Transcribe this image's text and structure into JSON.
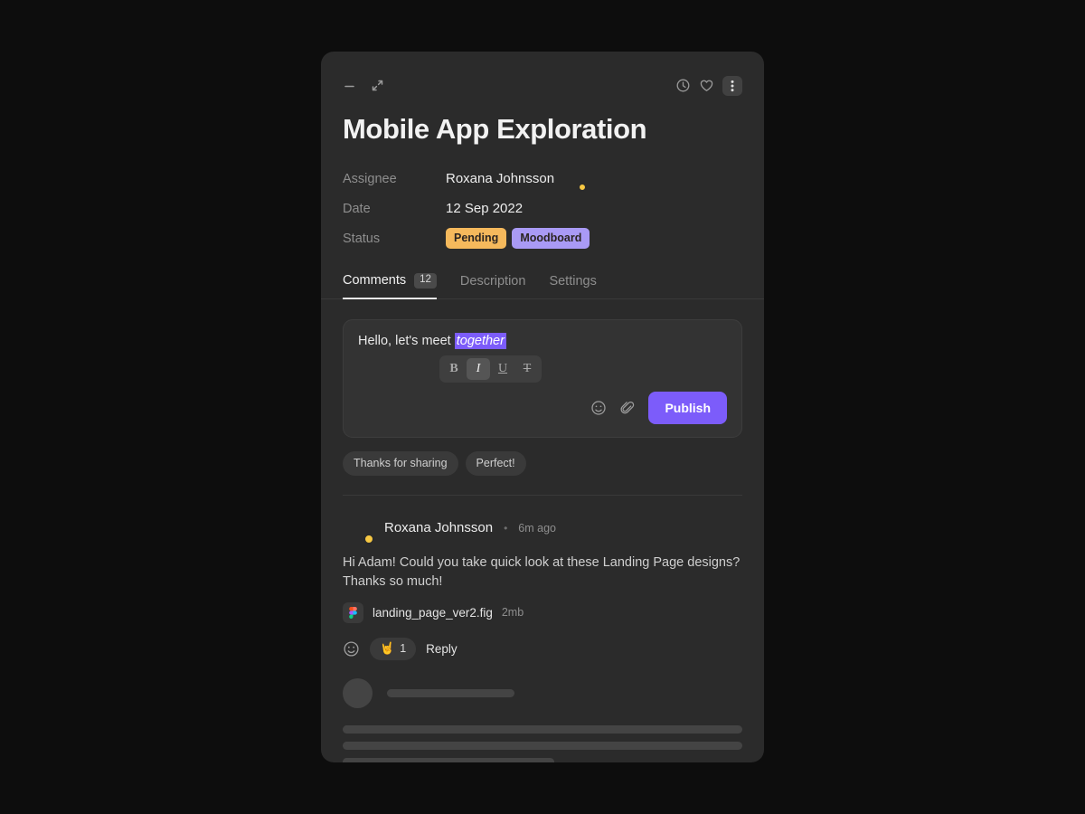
{
  "window": {
    "minimize_label": "minimize",
    "expand_label": "expand",
    "history_label": "history",
    "favorite_label": "favorite",
    "more_label": "more options"
  },
  "title": "Mobile App Exploration",
  "meta": [
    {
      "label": "Assignee",
      "value": "Roxana Johnsson"
    },
    {
      "label": "Date",
      "value": "12 Sep 2022"
    },
    {
      "label": "Status",
      "value": ""
    }
  ],
  "status_badges": [
    {
      "text": "Pending",
      "color": "#f5b95c"
    },
    {
      "text": "Moodboard",
      "color": "#a99af5"
    }
  ],
  "tabs": [
    {
      "label": "Comments",
      "badge": "12",
      "active": true
    },
    {
      "label": "Description",
      "badge": "",
      "active": false
    },
    {
      "label": "Settings",
      "badge": "",
      "active": false
    }
  ],
  "composer": {
    "text_before": "Hello, let's meet ",
    "selected_text": "together",
    "format_buttons": [
      {
        "glyph": "B",
        "name": "bold",
        "active": false
      },
      {
        "glyph": "I",
        "name": "italic",
        "active": true
      },
      {
        "glyph": "U",
        "name": "underline",
        "active": false
      },
      {
        "glyph": "T",
        "name": "strikethrough",
        "active": false
      }
    ],
    "emoji_label": "emoji",
    "attach_label": "attach file",
    "publish_label": "Publish",
    "accent_color": "#7c5cfa"
  },
  "suggestions": [
    {
      "label": "Thanks for sharing"
    },
    {
      "label": "Perfect!"
    }
  ],
  "comment": {
    "author": "Roxana Johnsson",
    "separator": "•",
    "time": "6m ago",
    "body": "Hi Adam! Could you take quick look at these Landing Page designs? Thanks so much!",
    "file_name": "landing_page_ver2.fig",
    "file_size": "2mb",
    "add_reaction_label": "add reaction",
    "reaction_emoji": "🤘",
    "reaction_count": "1",
    "reply_label": "Reply"
  },
  "skeleton": {
    "head_bar_width": "32%",
    "line_widths": [
      "100%",
      "100%",
      "53%"
    ]
  }
}
